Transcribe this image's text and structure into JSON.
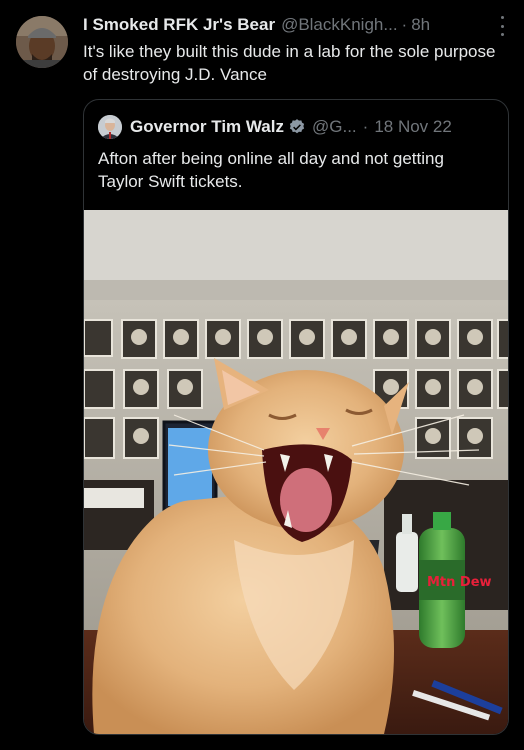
{
  "tweet": {
    "display_name": "I Smoked RFK Jr's Bear",
    "handle": "@BlackKnigh...",
    "separator": "·",
    "time": "8h",
    "text": "It's like they built this dude in a lab for the sole purpose of destroying J.D. Vance"
  },
  "quoted": {
    "display_name": "Governor Tim Walz",
    "handle": "@G...",
    "separator": "·",
    "date": "18 Nov 22",
    "text": "Afton after being online all day and not getting Taylor Swift tickets."
  },
  "photo": {
    "bottle_label": "Mtn Dew"
  },
  "colors": {
    "background": "#000000",
    "text_primary": "#e7e9ea",
    "text_secondary": "#71767b",
    "border": "#2f3336",
    "verified": "#1d9bf0"
  },
  "icons": [
    "avatar",
    "more-icon",
    "verified-badge-icon"
  ]
}
